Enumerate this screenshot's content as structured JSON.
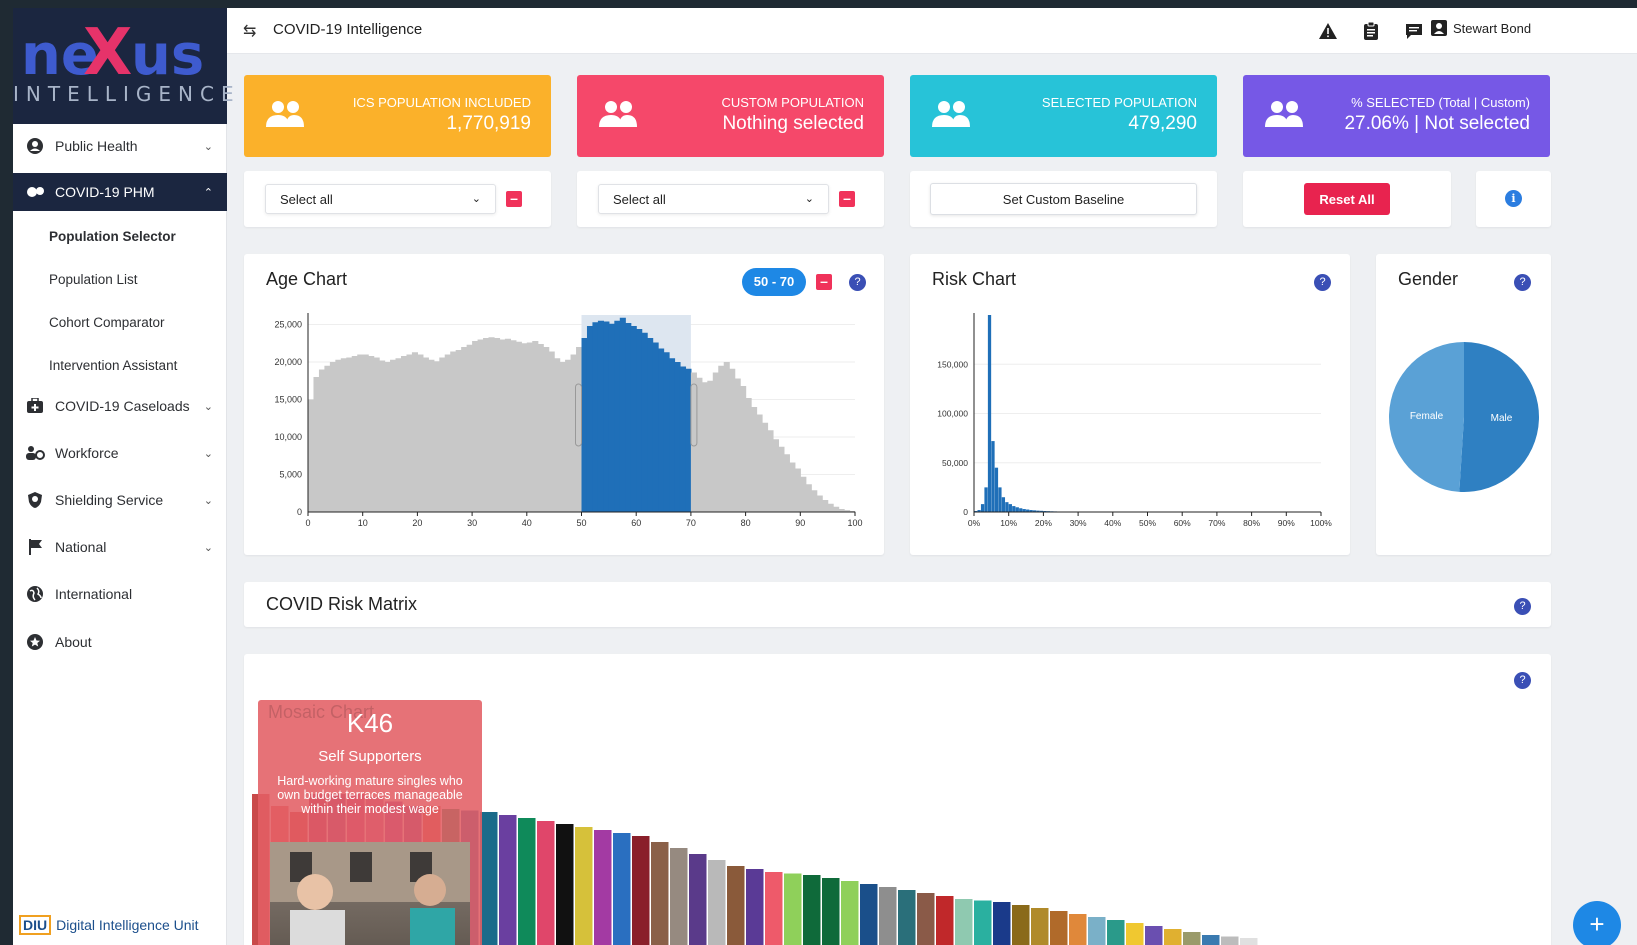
{
  "brand": {
    "logo_main": "neXus",
    "logo_sub": "INTELLIGENCE",
    "footer_text": "Digital Intelligence Unit",
    "footer_badge": "DIU"
  },
  "sidebar": {
    "items": [
      {
        "label": "Public Health",
        "icon": "user-circle-icon",
        "expanded": false
      },
      {
        "label": "COVID-19 PHM",
        "icon": "virus-icon",
        "expanded": true,
        "active": true
      },
      {
        "label": "COVID-19 Caseloads",
        "icon": "first-aid-kit-icon",
        "expanded": false
      },
      {
        "label": "Workforce",
        "icon": "users-cog-icon",
        "expanded": false
      },
      {
        "label": "Shielding Service",
        "icon": "shield-icon",
        "expanded": false
      },
      {
        "label": "National",
        "icon": "flag-icon",
        "expanded": false
      },
      {
        "label": "International",
        "icon": "globe-icon"
      },
      {
        "label": "About",
        "icon": "star-circle-icon"
      }
    ],
    "subitems": [
      "Population Selector",
      "Population List",
      "Cohort Comparator",
      "Intervention Assistant"
    ],
    "selected_subitem": "Population Selector"
  },
  "topbar": {
    "title": "COVID-19 Intelligence",
    "user": "Stewart Bond"
  },
  "stats": [
    {
      "label": "ICS POPULATION INCLUDED",
      "value": "1,770,919",
      "color": "#fbb12a"
    },
    {
      "label": "CUSTOM POPULATION",
      "value": "Nothing selected",
      "color": "#f5486a"
    },
    {
      "label": "SELECTED POPULATION",
      "value": "479,290",
      "color": "#27c3d8"
    },
    {
      "label": "% SELECTED (Total | Custom)",
      "value": "27.06% | Not selected",
      "color": "#7658e6"
    }
  ],
  "controls": {
    "select1": "Select all",
    "select2": "Select all",
    "baseline_button": "Set Custom Baseline",
    "reset_button": "Reset All"
  },
  "age_chart": {
    "title": "Age Chart",
    "range_label": "50 - 70"
  },
  "risk_chart": {
    "title": "Risk Chart"
  },
  "gender_chart": {
    "title": "Gender"
  },
  "risk_matrix": {
    "title": "COVID Risk Matrix"
  },
  "mosaic": {
    "title": "Mosaic Chart",
    "card": {
      "code": "K46",
      "name": "Self Supporters",
      "description": "Hard-working mature singles who own budget terraces manageable within their modest wage"
    }
  },
  "chart_data": [
    {
      "type": "area",
      "name": "Age Chart",
      "x_ticks": [
        "0",
        "10",
        "20",
        "30",
        "40",
        "50",
        "60",
        "70",
        "80",
        "90",
        "100"
      ],
      "y_ticks": [
        "0",
        "5,000",
        "10,000",
        "15,000",
        "20,000",
        "25,000"
      ],
      "xlim": [
        0,
        100
      ],
      "ylim": [
        0,
        26000
      ],
      "selection": [
        50,
        70
      ],
      "colors": {
        "base": "#c8c8c8",
        "selected": "#1f6fb8"
      },
      "values": [
        15000,
        18000,
        19000,
        19500,
        20000,
        20300,
        20500,
        20600,
        20800,
        21000,
        21000,
        20800,
        20600,
        20200,
        20000,
        20300,
        20500,
        20800,
        21000,
        21300,
        21000,
        20600,
        20300,
        20100,
        20600,
        21000,
        21400,
        21600,
        22000,
        22300,
        22800,
        23000,
        23200,
        23300,
        23200,
        23000,
        23100,
        22900,
        22700,
        22500,
        22600,
        22800,
        22400,
        22000,
        21400,
        20500,
        20000,
        20300,
        21000,
        22000,
        23200,
        24800,
        25300,
        25500,
        25400,
        25100,
        25500,
        25900,
        25200,
        24800,
        24400,
        23900,
        23200,
        22600,
        21800,
        21300,
        20500,
        20000,
        19400,
        19100,
        18600,
        17900,
        17300,
        17500,
        18600,
        19500,
        20000,
        19100,
        17800,
        16800,
        15200,
        14000,
        13000,
        11900,
        10900,
        9700,
        8700,
        7700,
        6600,
        5800,
        4700,
        3700,
        2900,
        2200,
        1600,
        1100,
        700,
        400,
        250,
        130
      ]
    },
    {
      "type": "bar",
      "name": "Risk Chart",
      "x_ticks": [
        "0%",
        "10%",
        "20%",
        "30%",
        "40%",
        "50%",
        "60%",
        "70%",
        "80%",
        "90%",
        "100%"
      ],
      "y_ticks": [
        "0",
        "50,000",
        "100,000",
        "150,000"
      ],
      "xlim": [
        0,
        100
      ],
      "ylim": [
        0,
        200000
      ],
      "color": "#1f6fb8",
      "values": [
        1000,
        2000,
        8000,
        25000,
        200000,
        72000,
        45000,
        25000,
        15000,
        10000,
        8000,
        6000,
        4800,
        3800,
        3000,
        2500,
        2000,
        1700,
        1400,
        1200,
        1000,
        850,
        720,
        600,
        500,
        420,
        360,
        300,
        250,
        210,
        180,
        150,
        120,
        100,
        85,
        70,
        60,
        50,
        40,
        30
      ]
    },
    {
      "type": "pie",
      "name": "Gender",
      "labels": [
        "Female",
        "Male"
      ],
      "values": [
        49,
        51
      ],
      "colors": [
        "#5aa1d6",
        "#2f80c2"
      ]
    },
    {
      "type": "bar",
      "name": "Mosaic Chart",
      "colors": [
        "#c94a4a",
        "#e05a5a",
        "#cf3a3a",
        "#a52f6e",
        "#8b3a8b",
        "#b83d8a",
        "#c0589b",
        "#9b3ea0",
        "#7b3f96",
        "#d2563b",
        "#0f8a5a",
        "#2b5aa0",
        "#1a6b8a",
        "#6a3fa0",
        "#0f8a5a",
        "#e0466a",
        "#111111",
        "#d6c13a",
        "#a33aa3",
        "#2a6fc0",
        "#8a1f2a",
        "#8a6048",
        "#968a80",
        "#5a3a8a",
        "#b9b9b9",
        "#8a5a3a",
        "#5a3a96",
        "#ee5a6a",
        "#8fd05a",
        "#0f6a3a",
        "#0f6a3a",
        "#8fd05a",
        "#1a4f8a",
        "#8e8e8e",
        "#2a6f7a",
        "#8a5a48",
        "#c0282a",
        "#8fc9b0",
        "#2ab0a0",
        "#1a3a8a",
        "#8a6a1a",
        "#b08a2a",
        "#b06a2a",
        "#e0883a",
        "#7ab0c8",
        "#2a9a8a",
        "#f0c830",
        "#6a4fb0",
        "#e0b030",
        "#9a9a6a",
        "#3a7ab0",
        "#bcbcbc",
        "#e0e0e0"
      ],
      "values": [
        100,
        92,
        88,
        100,
        100,
        100,
        98,
        95,
        92,
        92,
        90,
        89,
        88,
        86,
        84,
        82,
        80,
        78,
        76,
        74,
        72,
        68,
        64,
        60,
        56,
        52,
        50,
        48,
        47,
        46,
        44,
        42,
        40,
        38,
        36,
        34,
        32,
        30,
        29,
        28,
        26,
        24,
        22,
        20,
        18,
        16,
        14,
        12,
        10,
        8,
        6,
        5,
        4
      ]
    }
  ]
}
